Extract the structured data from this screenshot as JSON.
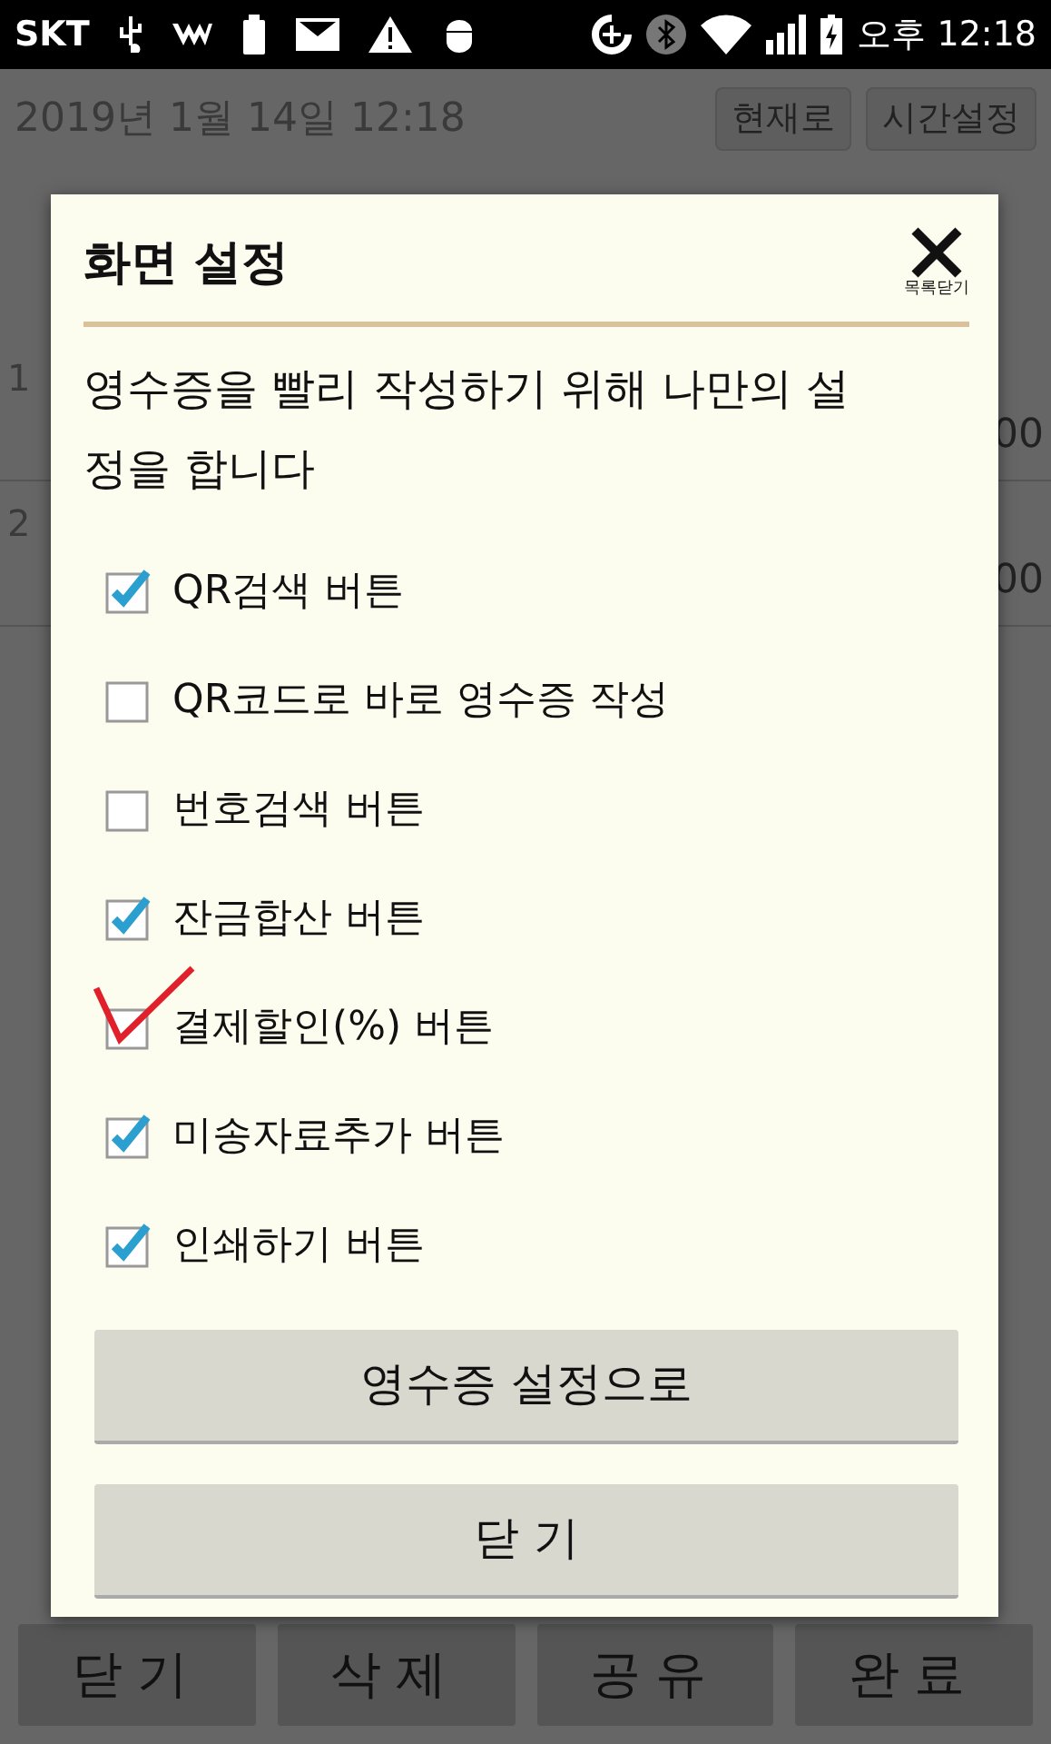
{
  "status_bar": {
    "carrier": "SKT",
    "time": "오후 12:18"
  },
  "background": {
    "date": "2019년 1월 14일 12:18",
    "buttons": [
      "현재로",
      "시간설정"
    ],
    "rows": [
      {
        "number": "1",
        "amount": "00"
      },
      {
        "number": "2",
        "amount": "00"
      }
    ],
    "bottom_buttons": [
      "닫기",
      "삭제",
      "공유",
      "완료"
    ]
  },
  "dialog": {
    "title": "화면 설정",
    "close_label": "목록닫기",
    "description": "영수증을 빨리 작성하기 위해 나만의 설정을 합니다",
    "options": [
      {
        "label": "QR검색 버튼",
        "checked": true,
        "marked": false
      },
      {
        "label": "QR코드로 바로 영수증 작성",
        "checked": false,
        "marked": false
      },
      {
        "label": "번호검색 버튼",
        "checked": false,
        "marked": false
      },
      {
        "label": "잔금합산 버튼",
        "checked": true,
        "marked": false
      },
      {
        "label": "결제할인(%) 버튼",
        "checked": false,
        "marked": true
      },
      {
        "label": "미송자료추가 버튼",
        "checked": true,
        "marked": false
      },
      {
        "label": "인쇄하기 버튼",
        "checked": true,
        "marked": false
      }
    ],
    "buttons": [
      "영수증 설정으로",
      "닫 기"
    ]
  }
}
